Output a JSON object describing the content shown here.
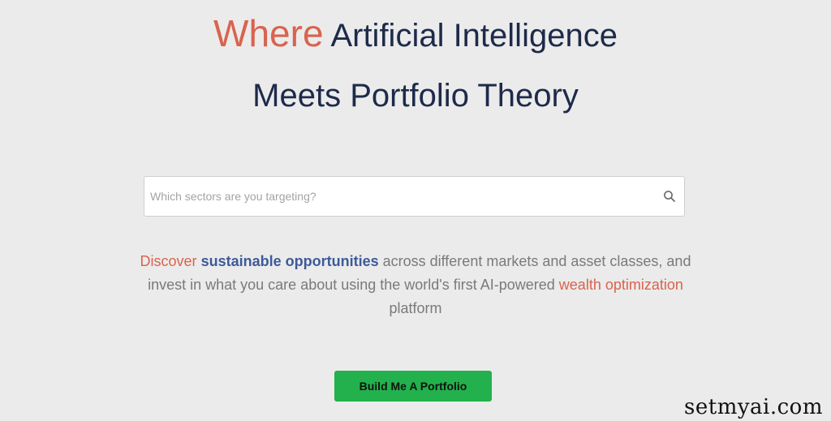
{
  "hero": {
    "accent_word": "Where",
    "line1_rest": " Artificial Intelligence",
    "line2": "Meets Portfolio Theory"
  },
  "search": {
    "placeholder": "Which sectors are you targeting?",
    "value": "",
    "icon": "search-icon"
  },
  "tagline": {
    "part1": "Discover",
    "part2": " ",
    "part3": "sustainable opportunities",
    "part4": " across different markets and asset classes, and invest in what you care about using the world's first AI-powered ",
    "part5": "wealth optimization",
    "part6": " platform"
  },
  "cta": {
    "label": "Build Me A Portfolio"
  },
  "watermark": {
    "text": "setmyai.com"
  },
  "colors": {
    "background": "#ebebeb",
    "accent_red": "#d9634e",
    "heading_navy": "#1e2a4a",
    "link_blue": "#3d5a98",
    "button_green": "#22b14c"
  }
}
